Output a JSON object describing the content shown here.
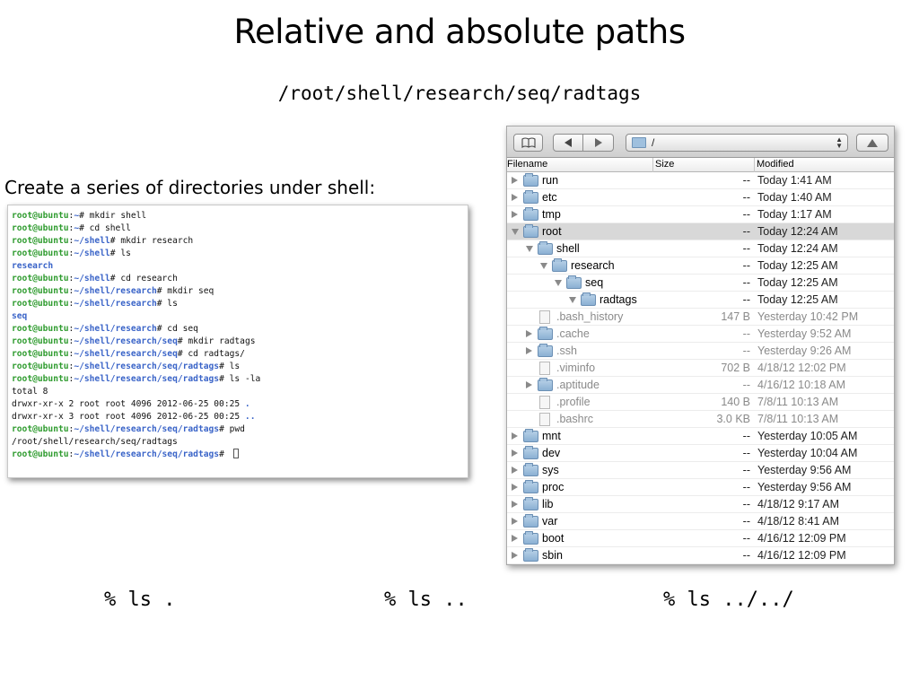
{
  "slide": {
    "title": "Relative and absolute paths",
    "path": "/root/shell/research/seq/radtags",
    "caption": "Create a series of directories under shell:"
  },
  "terminal": {
    "lines": [
      {
        "type": "prompt",
        "user": "root@ubuntu",
        "path": "~",
        "cmd": "mkdir shell"
      },
      {
        "type": "prompt",
        "user": "root@ubuntu",
        "path": "~",
        "cmd": "cd shell"
      },
      {
        "type": "prompt",
        "user": "root@ubuntu",
        "path": "~/shell",
        "cmd": "mkdir research"
      },
      {
        "type": "prompt",
        "user": "root@ubuntu",
        "path": "~/shell",
        "cmd": "ls"
      },
      {
        "type": "dir",
        "text": "research"
      },
      {
        "type": "prompt",
        "user": "root@ubuntu",
        "path": "~/shell",
        "cmd": "cd research"
      },
      {
        "type": "prompt",
        "user": "root@ubuntu",
        "path": "~/shell/research",
        "cmd": "mkdir seq"
      },
      {
        "type": "prompt",
        "user": "root@ubuntu",
        "path": "~/shell/research",
        "cmd": "ls"
      },
      {
        "type": "dir",
        "text": "seq"
      },
      {
        "type": "prompt",
        "user": "root@ubuntu",
        "path": "~/shell/research",
        "cmd": "cd seq"
      },
      {
        "type": "prompt",
        "user": "root@ubuntu",
        "path": "~/shell/research/seq",
        "cmd": "mkdir radtags"
      },
      {
        "type": "prompt",
        "user": "root@ubuntu",
        "path": "~/shell/research/seq",
        "cmd": "cd radtags/"
      },
      {
        "type": "prompt",
        "user": "root@ubuntu",
        "path": "~/shell/research/seq/radtags",
        "cmd": "ls"
      },
      {
        "type": "prompt",
        "user": "root@ubuntu",
        "path": "~/shell/research/seq/radtags",
        "cmd": "ls -la"
      },
      {
        "type": "out",
        "text": "total 8"
      },
      {
        "type": "lsout",
        "text": "drwxr-xr-x 2 root root 4096 2012-06-25 00:25 ",
        "dir": "."
      },
      {
        "type": "lsout",
        "text": "drwxr-xr-x 3 root root 4096 2012-06-25 00:25 ",
        "dir": ".."
      },
      {
        "type": "prompt",
        "user": "root@ubuntu",
        "path": "~/shell/research/seq/radtags",
        "cmd": "pwd"
      },
      {
        "type": "out",
        "text": "/root/shell/research/seq/radtags"
      },
      {
        "type": "prompt",
        "user": "root@ubuntu",
        "path": "~/shell/research/seq/radtags",
        "cmd": "",
        "cursor": true
      }
    ]
  },
  "finder": {
    "path_label": "/",
    "columns": {
      "filename": "Filename",
      "size": "Size",
      "modified": "Modified"
    },
    "rows": [
      {
        "name": "run",
        "level": 0,
        "kind": "folder",
        "disc": "closed",
        "size": "--",
        "modified": "Today 1:41 AM"
      },
      {
        "name": "etc",
        "level": 0,
        "kind": "folder",
        "disc": "closed",
        "size": "--",
        "modified": "Today 1:40 AM"
      },
      {
        "name": "tmp",
        "level": 0,
        "kind": "folder",
        "disc": "closed",
        "size": "--",
        "modified": "Today 1:17 AM"
      },
      {
        "name": "root",
        "level": 0,
        "kind": "folder",
        "disc": "open",
        "size": "--",
        "modified": "Today 12:24 AM",
        "selected": true
      },
      {
        "name": "shell",
        "level": 1,
        "kind": "folder",
        "disc": "open",
        "size": "--",
        "modified": "Today 12:24 AM"
      },
      {
        "name": "research",
        "level": 2,
        "kind": "folder",
        "disc": "open",
        "size": "--",
        "modified": "Today 12:25 AM"
      },
      {
        "name": "seq",
        "level": 3,
        "kind": "folder",
        "disc": "open",
        "size": "--",
        "modified": "Today 12:25 AM"
      },
      {
        "name": "radtags",
        "level": 4,
        "kind": "folder",
        "disc": "open",
        "size": "--",
        "modified": "Today 12:25 AM"
      },
      {
        "name": ".bash_history",
        "level": 1,
        "kind": "file",
        "disc": "none",
        "size": "147 B",
        "modified": "Yesterday 10:42 PM",
        "dim": true
      },
      {
        "name": ".cache",
        "level": 1,
        "kind": "folder",
        "disc": "closed",
        "size": "--",
        "modified": "Yesterday 9:52 AM",
        "dim": true
      },
      {
        "name": ".ssh",
        "level": 1,
        "kind": "folder",
        "disc": "closed",
        "size": "--",
        "modified": "Yesterday 9:26 AM",
        "dim": true
      },
      {
        "name": ".viminfo",
        "level": 1,
        "kind": "file",
        "disc": "none",
        "size": "702 B",
        "modified": "4/18/12 12:02 PM",
        "dim": true
      },
      {
        "name": ".aptitude",
        "level": 1,
        "kind": "folder",
        "disc": "closed",
        "size": "--",
        "modified": "4/16/12 10:18 AM",
        "dim": true
      },
      {
        "name": ".profile",
        "level": 1,
        "kind": "file",
        "disc": "none",
        "size": "140 B",
        "modified": "7/8/11 10:13 AM",
        "dim": true
      },
      {
        "name": ".bashrc",
        "level": 1,
        "kind": "file",
        "disc": "none",
        "size": "3.0 KB",
        "modified": "7/8/11 10:13 AM",
        "dim": true
      },
      {
        "name": "mnt",
        "level": 0,
        "kind": "folder",
        "disc": "closed",
        "size": "--",
        "modified": "Yesterday 10:05 AM"
      },
      {
        "name": "dev",
        "level": 0,
        "kind": "folder",
        "disc": "closed",
        "size": "--",
        "modified": "Yesterday 10:04 AM"
      },
      {
        "name": "sys",
        "level": 0,
        "kind": "folder",
        "disc": "closed",
        "size": "--",
        "modified": "Yesterday 9:56 AM"
      },
      {
        "name": "proc",
        "level": 0,
        "kind": "folder",
        "disc": "closed",
        "size": "--",
        "modified": "Yesterday 9:56 AM"
      },
      {
        "name": "lib",
        "level": 0,
        "kind": "folder",
        "disc": "closed",
        "size": "--",
        "modified": "4/18/12 9:17 AM"
      },
      {
        "name": "var",
        "level": 0,
        "kind": "folder",
        "disc": "closed",
        "size": "--",
        "modified": "4/18/12 8:41 AM"
      },
      {
        "name": "boot",
        "level": 0,
        "kind": "folder",
        "disc": "closed",
        "size": "--",
        "modified": "4/16/12 12:09 PM"
      },
      {
        "name": "sbin",
        "level": 0,
        "kind": "folder",
        "disc": "closed",
        "size": "--",
        "modified": "4/16/12 12:09 PM"
      }
    ]
  },
  "commands": [
    "% ls .",
    "% ls ..",
    "% ls ../../"
  ],
  "colors": {
    "prompt_user": "#2e9b2e",
    "prompt_path": "#3a64c8",
    "selection": "#d8d8d8",
    "dim_text": "#8a8a8a"
  }
}
